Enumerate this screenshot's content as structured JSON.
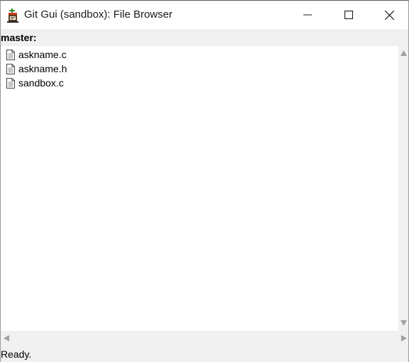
{
  "window": {
    "title": "Git Gui (sandbox): File Browser",
    "icon": "git-gui-icon"
  },
  "controls": {
    "minimize_icon": "minimize-icon",
    "maximize_icon": "maximize-icon",
    "close_icon": "close-icon"
  },
  "browser": {
    "branch_label": "master:",
    "files": [
      {
        "name": "askname.c",
        "icon": "file-icon"
      },
      {
        "name": "askname.h",
        "icon": "file-icon"
      },
      {
        "name": "sandbox.c",
        "icon": "file-icon"
      }
    ]
  },
  "status": {
    "text": "Ready."
  }
}
